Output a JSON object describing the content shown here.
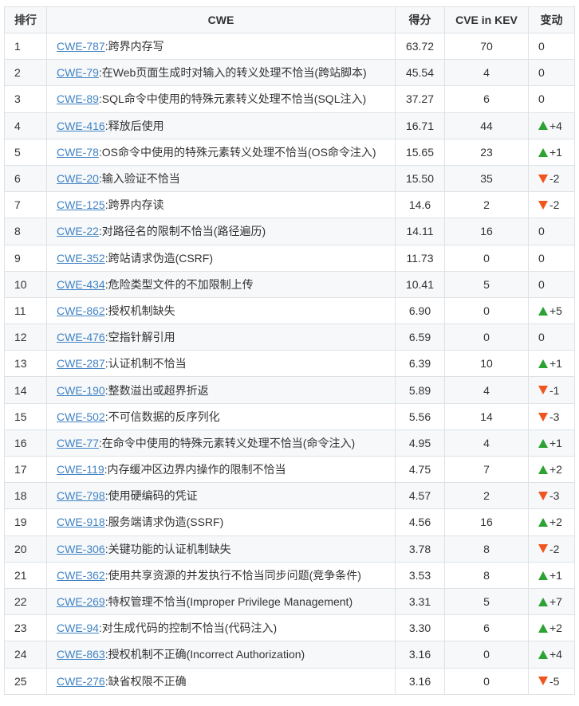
{
  "colors": {
    "link": "#4183c4",
    "up": "#2ba232",
    "down": "#f0551f",
    "header_bg": "#f6f8fa",
    "border": "#dfe2e5"
  },
  "table": {
    "headers": {
      "rank": "排行",
      "cwe": "CWE",
      "score": "得分",
      "kev": "CVE in KEV",
      "change": "变动"
    },
    "rows": [
      {
        "rank": "1",
        "cwe_id": "CWE-787",
        "desc": ":跨界内存写",
        "score": "63.72",
        "kev": "70",
        "dir": "none",
        "change": "0"
      },
      {
        "rank": "2",
        "cwe_id": "CWE-79",
        "desc": ":在Web页面生成时对输入的转义处理不恰当(跨站脚本)",
        "score": "45.54",
        "kev": "4",
        "dir": "none",
        "change": "0"
      },
      {
        "rank": "3",
        "cwe_id": "CWE-89",
        "desc": ":SQL命令中使用的特殊元素转义处理不恰当(SQL注入)",
        "score": "37.27",
        "kev": "6",
        "dir": "none",
        "change": "0"
      },
      {
        "rank": "4",
        "cwe_id": "CWE-416",
        "desc": ":释放后使用",
        "score": "16.71",
        "kev": "44",
        "dir": "up",
        "change": "+4"
      },
      {
        "rank": "5",
        "cwe_id": "CWE-78",
        "desc": ":OS命令中使用的特殊元素转义处理不恰当(OS命令注入)",
        "score": "15.65",
        "kev": "23",
        "dir": "up",
        "change": "+1"
      },
      {
        "rank": "6",
        "cwe_id": "CWE-20",
        "desc": ":输入验证不恰当",
        "score": "15.50",
        "kev": "35",
        "dir": "down",
        "change": "-2"
      },
      {
        "rank": "7",
        "cwe_id": "CWE-125",
        "desc": ":跨界内存读",
        "score": "14.6",
        "kev": "2",
        "dir": "down",
        "change": "-2"
      },
      {
        "rank": "8",
        "cwe_id": "CWE-22",
        "desc": ":对路径名的限制不恰当(路径遍历)",
        "score": "14.11",
        "kev": "16",
        "dir": "none",
        "change": "0"
      },
      {
        "rank": "9",
        "cwe_id": "CWE-352",
        "desc": ":跨站请求伪造(CSRF)",
        "score": "11.73",
        "kev": "0",
        "dir": "none",
        "change": "0"
      },
      {
        "rank": "10",
        "cwe_id": "CWE-434",
        "desc": ":危险类型文件的不加限制上传",
        "score": "10.41",
        "kev": "5",
        "dir": "none",
        "change": "0"
      },
      {
        "rank": "11",
        "cwe_id": "CWE-862",
        "desc": ":授权机制缺失",
        "score": "6.90",
        "kev": "0",
        "dir": "up",
        "change": "+5"
      },
      {
        "rank": "12",
        "cwe_id": "CWE-476",
        "desc": ":空指针解引用",
        "score": "6.59",
        "kev": "0",
        "dir": "none",
        "change": "0"
      },
      {
        "rank": "13",
        "cwe_id": "CWE-287",
        "desc": ":认证机制不恰当",
        "score": "6.39",
        "kev": "10",
        "dir": "up",
        "change": "+1"
      },
      {
        "rank": "14",
        "cwe_id": "CWE-190",
        "desc": ":整数溢出或超界折返",
        "score": "5.89",
        "kev": "4",
        "dir": "down",
        "change": "-1"
      },
      {
        "rank": "15",
        "cwe_id": "CWE-502",
        "desc": ":不可信数据的反序列化",
        "score": "5.56",
        "kev": "14",
        "dir": "down",
        "change": "-3"
      },
      {
        "rank": "16",
        "cwe_id": "CWE-77",
        "desc": ":在命令中使用的特殊元素转义处理不恰当(命令注入)",
        "score": "4.95",
        "kev": "4",
        "dir": "up",
        "change": "+1"
      },
      {
        "rank": "17",
        "cwe_id": "CWE-119",
        "desc": ":内存缓冲区边界内操作的限制不恰当",
        "score": "4.75",
        "kev": "7",
        "dir": "up",
        "change": "+2"
      },
      {
        "rank": "18",
        "cwe_id": "CWE-798",
        "desc": ":使用硬编码的凭证",
        "score": "4.57",
        "kev": "2",
        "dir": "down",
        "change": "-3"
      },
      {
        "rank": "19",
        "cwe_id": "CWE-918",
        "desc": ":服务端请求伪造(SSRF)",
        "score": "4.56",
        "kev": "16",
        "dir": "up",
        "change": "+2"
      },
      {
        "rank": "20",
        "cwe_id": "CWE-306",
        "desc": ":关键功能的认证机制缺失",
        "score": "3.78",
        "kev": "8",
        "dir": "down",
        "change": "-2"
      },
      {
        "rank": "21",
        "cwe_id": "CWE-362",
        "desc": ":使用共享资源的并发执行不恰当同步问题(竞争条件)",
        "score": "3.53",
        "kev": "8",
        "dir": "up",
        "change": "+1"
      },
      {
        "rank": "22",
        "cwe_id": "CWE-269",
        "desc": ":特权管理不恰当(Improper Privilege Management)",
        "score": "3.31",
        "kev": "5",
        "dir": "up",
        "change": "+7"
      },
      {
        "rank": "23",
        "cwe_id": "CWE-94",
        "desc": ":对生成代码的控制不恰当(代码注入)",
        "score": "3.30",
        "kev": "6",
        "dir": "up",
        "change": "+2"
      },
      {
        "rank": "24",
        "cwe_id": "CWE-863",
        "desc": ":授权机制不正确(Incorrect Authorization)",
        "score": "3.16",
        "kev": "0",
        "dir": "up",
        "change": "+4"
      },
      {
        "rank": "25",
        "cwe_id": "CWE-276",
        "desc": ":缺省权限不正确",
        "score": "3.16",
        "kev": "0",
        "dir": "down",
        "change": "-5"
      }
    ]
  }
}
